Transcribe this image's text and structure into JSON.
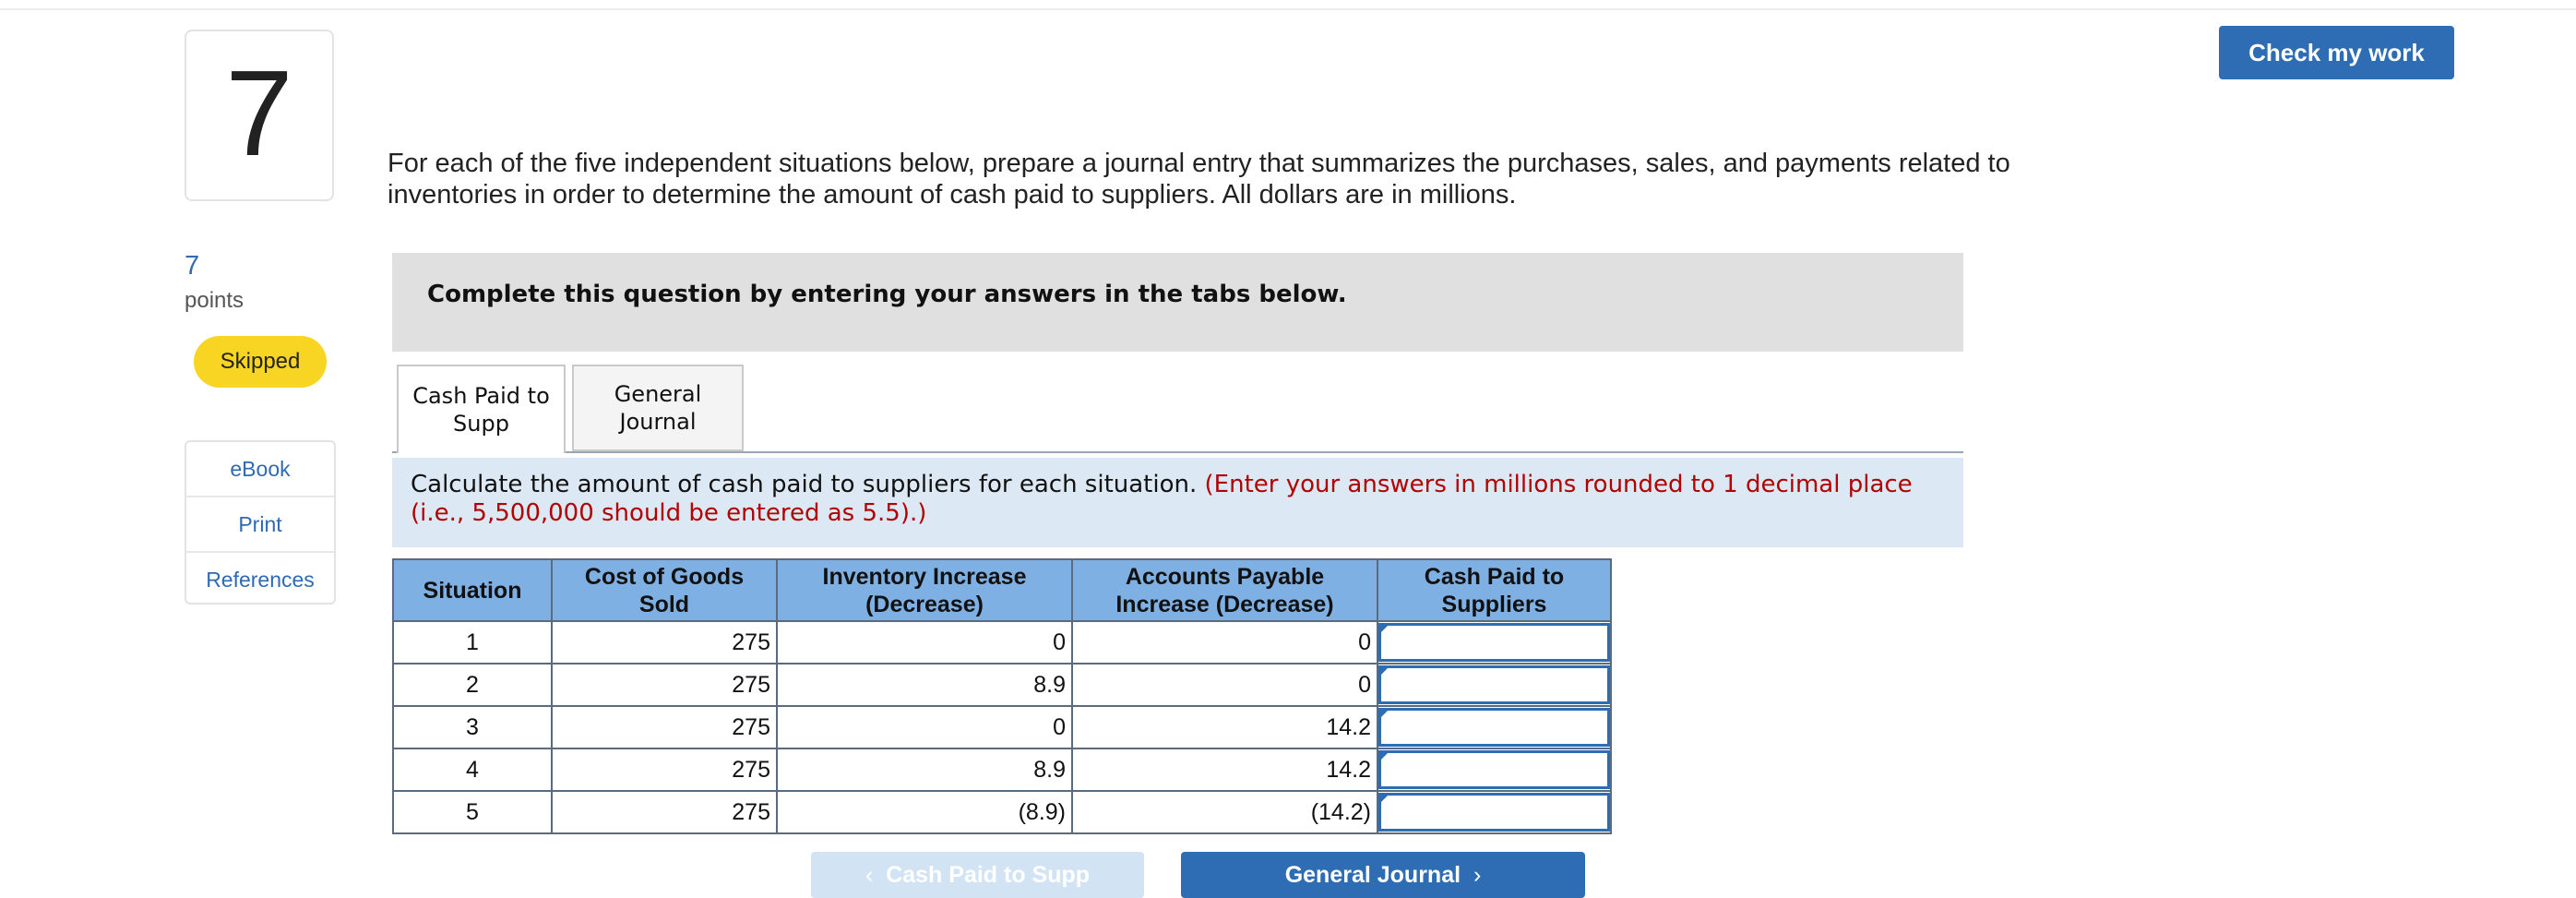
{
  "header": {
    "check_label": "Check my work"
  },
  "question": {
    "number": "7",
    "points_value": "7",
    "points_label": "points",
    "status": "Skipped",
    "text": "For each of the five independent situations below, prepare a journal entry that summarizes the purchases, sales, and payments related to inventories in order to determine the amount of cash paid to suppliers. All dollars are in millions."
  },
  "side_links": [
    "eBook",
    "Print",
    "References"
  ],
  "banner": "Complete this question by entering your answers in the tabs below.",
  "tabs": [
    {
      "label": "Cash Paid to Supp",
      "active": true
    },
    {
      "label": "General Journal",
      "active": false
    }
  ],
  "instruction": {
    "main": "Calculate the amount of cash paid to suppliers for each situation.",
    "note": "(Enter your answers in millions rounded to 1 decimal place (i.e., 5,500,000 should be entered as 5.5).)"
  },
  "table": {
    "headers": [
      "Situation",
      "Cost of Goods Sold",
      "Inventory Increase (Decrease)",
      "Accounts Payable Increase (Decrease)",
      "Cash Paid to Suppliers"
    ],
    "rows": [
      {
        "situation": "1",
        "cogs": "275",
        "inventory": "0",
        "payable": "0",
        "cash": ""
      },
      {
        "situation": "2",
        "cogs": "275",
        "inventory": "8.9",
        "payable": "0",
        "cash": ""
      },
      {
        "situation": "3",
        "cogs": "275",
        "inventory": "0",
        "payable": "14.2",
        "cash": ""
      },
      {
        "situation": "4",
        "cogs": "275",
        "inventory": "8.9",
        "payable": "14.2",
        "cash": ""
      },
      {
        "situation": "5",
        "cogs": "275",
        "inventory": "(8.9)",
        "payable": "(14.2)",
        "cash": ""
      }
    ]
  },
  "nav": {
    "prev_label": "Cash Paid to Supp",
    "prev_icon": "chevron-left-icon",
    "next_label": "General Journal",
    "next_icon": "chevron-right-icon"
  },
  "colors": {
    "accent": "#2e6db4",
    "skipped_badge": "#f9d523",
    "table_header": "#7fb0e3",
    "instruction_bg": "#dce9f5",
    "note_red": "#b00000"
  }
}
